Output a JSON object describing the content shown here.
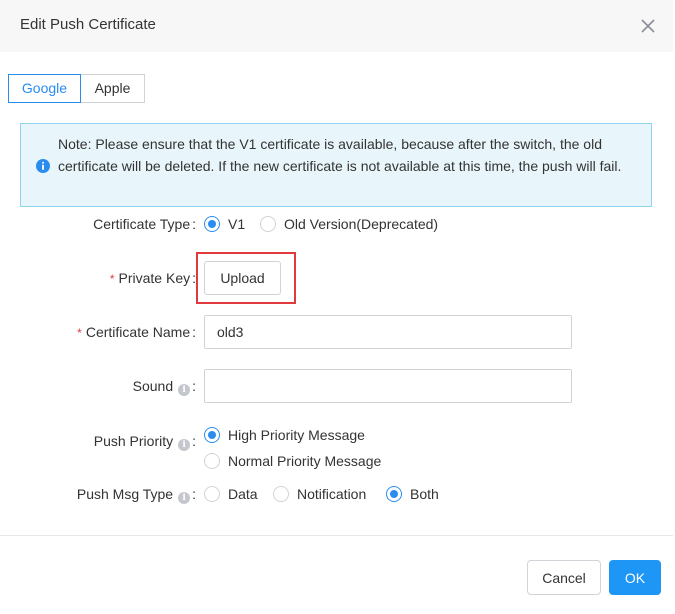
{
  "dialog": {
    "title": "Edit Push Certificate",
    "close_icon": "close-icon"
  },
  "tabs": [
    {
      "label": "Google",
      "active": true
    },
    {
      "label": "Apple",
      "active": false
    }
  ],
  "notice": {
    "icon": "info-icon",
    "text": "Note: Please ensure that the V1 certificate is available, because after the switch, the old certificate will be deleted. If the new certificate is not available at this time, the push will fail."
  },
  "form": {
    "certificate_type": {
      "label": "Certificate Type",
      "options": [
        {
          "label": "V1",
          "selected": true
        },
        {
          "label": "Old Version(Deprecated)",
          "selected": false
        }
      ]
    },
    "private_key": {
      "label": "Private Key",
      "required": true,
      "button_label": "Upload"
    },
    "certificate_name": {
      "label": "Certificate Name",
      "required": true,
      "value": "old3"
    },
    "sound": {
      "label": "Sound",
      "value": ""
    },
    "push_priority": {
      "label": "Push Priority",
      "options": [
        {
          "label": "High Priority Message",
          "selected": true
        },
        {
          "label": "Normal Priority Message",
          "selected": false
        }
      ]
    },
    "push_msg_type": {
      "label": "Push Msg Type",
      "options": [
        {
          "label": "Data",
          "selected": false
        },
        {
          "label": "Notification",
          "selected": false
        },
        {
          "label": "Both",
          "selected": true
        }
      ]
    }
  },
  "footer": {
    "cancel_label": "Cancel",
    "ok_label": "OK"
  },
  "colors": {
    "accent": "#2b8cf0",
    "ok_button": "#1e96f5",
    "required": "#e0393e",
    "notice_bg": "#e8f6fb",
    "notice_border": "#8fd3ec",
    "highlight_box": "#e0393e"
  }
}
